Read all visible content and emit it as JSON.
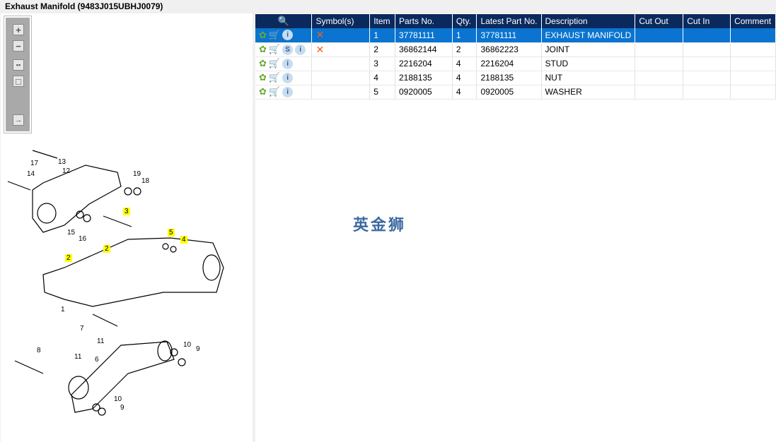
{
  "title": "Exhaust Manifold (9483J015UBHJ0079)",
  "toolbar": [
    "zoom-in",
    "zoom-out",
    "fit-all",
    "actual-size",
    "toggle-panel"
  ],
  "table": {
    "headers": [
      "",
      "Symbol(s)",
      "Item",
      "Parts No.",
      "Qty.",
      "Latest Part No.",
      "Description",
      "Cut Out",
      "Cut In",
      "Comment"
    ],
    "rows": [
      {
        "item": "1",
        "part": "37781111",
        "qty": "1",
        "latest": "37781111",
        "desc": "EXHAUST MANIFOLD",
        "s": false,
        "x": true,
        "selected": true
      },
      {
        "item": "2",
        "part": "36862144",
        "qty": "2",
        "latest": "36862223",
        "desc": "JOINT",
        "s": true,
        "x": true
      },
      {
        "item": "3",
        "part": "2216204",
        "qty": "4",
        "latest": "2216204",
        "desc": "STUD",
        "s": false,
        "x": false
      },
      {
        "item": "4",
        "part": "2188135",
        "qty": "4",
        "latest": "2188135",
        "desc": "NUT",
        "s": false,
        "x": false
      },
      {
        "item": "5",
        "part": "0920005",
        "qty": "4",
        "latest": "0920005",
        "desc": "WASHER",
        "s": false,
        "x": false
      }
    ]
  },
  "watermark": "英金狮",
  "callouts": [
    "17",
    "13",
    "12",
    "14",
    "19",
    "18",
    "3",
    "15",
    "16",
    "5",
    "4",
    "2",
    "2",
    "1",
    "7",
    "11",
    "10",
    "9",
    "8",
    "11",
    "6",
    "10",
    "9"
  ],
  "icons": {
    "s": "S",
    "i": "i"
  },
  "colors": {
    "header": "#0a2a5e",
    "selected": "#0a74d0",
    "highlight": "#ffff00"
  }
}
